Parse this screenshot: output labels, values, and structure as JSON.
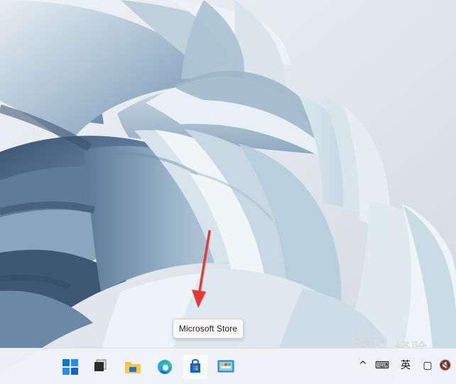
{
  "tooltip": {
    "label": "Microsoft Store"
  },
  "taskbar": {
    "apps": [
      {
        "name": "start-button",
        "icon": "windows-logo-icon"
      },
      {
        "name": "task-view-button",
        "icon": "task-view-icon"
      },
      {
        "name": "file-explorer-button",
        "icon": "folder-icon"
      },
      {
        "name": "edge-button",
        "icon": "edge-icon"
      },
      {
        "name": "microsoft-store-button",
        "icon": "store-icon"
      },
      {
        "name": "control-panel-button",
        "icon": "control-panel-icon"
      }
    ],
    "tray": {
      "expand": "^",
      "keyboard": "⌨",
      "input_mode": "英",
      "notification": "▢",
      "volume": "🔇"
    }
  },
  "colors": {
    "accent": "#0078d4",
    "store_blue": "#0b63ce",
    "arrow_red": "#e53935",
    "taskbar": "#eff3f8"
  },
  "watermark": {
    "left": "Baid",
    "right": "经验",
    "sub": "jingyan.baidu.com"
  }
}
